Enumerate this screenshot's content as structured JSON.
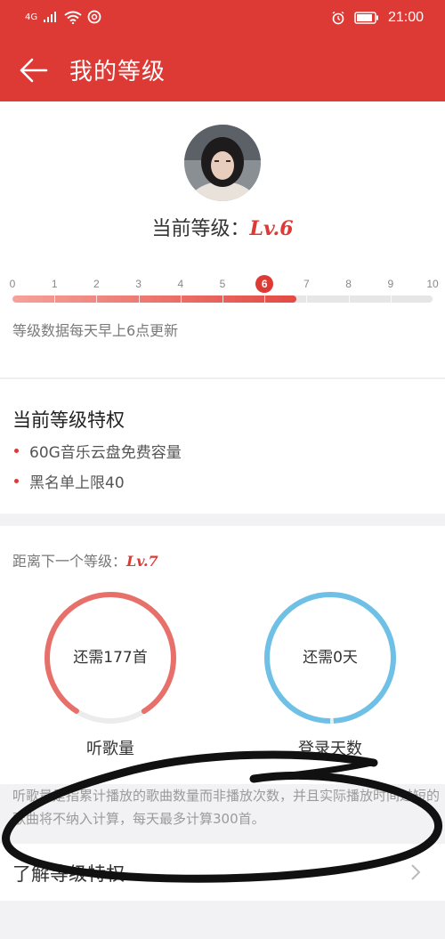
{
  "status_bar": {
    "network": "4G",
    "time": "21:00"
  },
  "header": {
    "title": "我的等级"
  },
  "level": {
    "current_label": "当前等级：",
    "current_value": "Lv.6",
    "scale": [
      "0",
      "1",
      "2",
      "3",
      "4",
      "5",
      "6",
      "7",
      "8",
      "9",
      "10"
    ],
    "current_index": 6,
    "update_note": "等级数据每天早上6点更新"
  },
  "privileges": {
    "title": "当前等级特权",
    "items": [
      "60G音乐云盘免费容量",
      "黑名单上限40"
    ]
  },
  "next": {
    "label": "距离下一个等级：",
    "level": "Lv.7",
    "rings": [
      {
        "text": "还需177首",
        "label": "听歌量",
        "color": "#e8706a",
        "progress": 0.82
      },
      {
        "text": "还需0天",
        "label": "登录天数",
        "color": "#6fc0e6",
        "progress": 1.0
      }
    ]
  },
  "footnote": "听歌量是指累计播放的歌曲数量而非播放次数，并且实际播放时间过短的歌曲将不纳入计算，每天最多计算300首。",
  "learn_more": "了解等级特权",
  "colors": {
    "accent": "#dd3a35"
  }
}
